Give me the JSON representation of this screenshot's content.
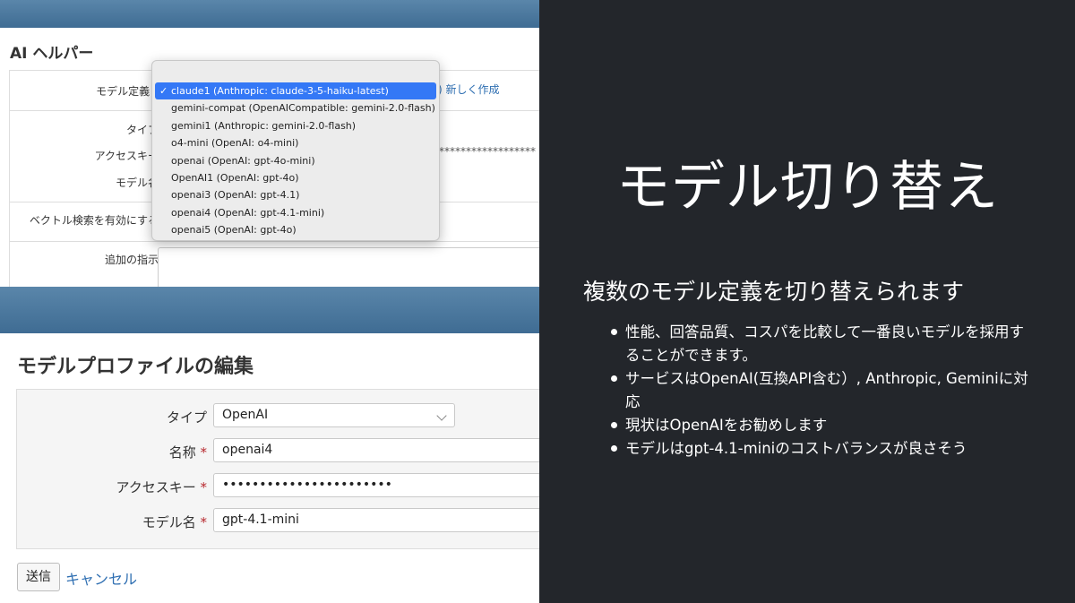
{
  "top_screen": {
    "page_title": "AI ヘルパー",
    "fields": {
      "model_definition_label": "モデル定義",
      "type_label": "タイプ",
      "access_key_label": "アクセスキー",
      "model_name_label": "モデル名",
      "vector_search_label": "ベクトル検索を有効にする",
      "extra_instructions_label": "追加の指示"
    },
    "required_mark": "*",
    "new_link": ") 新しく作成",
    "masked_value": "******************",
    "dropdown": {
      "check_mark": "✓",
      "options": [
        "claude1 (Anthropic: claude-3-5-haiku-latest)",
        "gemini-compat (OpenAICompatible: gemini-2.0-flash)",
        "gemini1 (Anthropic: gemini-2.0-flash)",
        "o4-mini (OpenAI: o4-mini)",
        "openai (OpenAI: gpt-4o-mini)",
        "OpenAI1 (OpenAI: gpt-4o)",
        "openai3 (OpenAI: gpt-4.1)",
        "openai4 (OpenAI: gpt-4.1-mini)",
        "openai5 (OpenAI: gpt-4o)"
      ],
      "selected_index": 0
    }
  },
  "bottom_screen": {
    "title": "モデルプロファイルの編集",
    "type_label": "タイプ",
    "type_value": "OpenAI",
    "name_label": "名称",
    "name_value": "openai4",
    "access_key_label": "アクセスキー",
    "access_key_value": "•••••••••••••••••••••••",
    "model_name_label": "モデル名",
    "model_name_value": "gpt-4.1-mini",
    "required_mark": "*",
    "submit_label": "送信",
    "cancel_label": "キャンセル"
  },
  "slide": {
    "title": "モデル切り替え",
    "subtitle": "複数のモデル定義を切り替えられます",
    "bullets": [
      "性能、回答品質、コスパを比較して一番良いモデルを採用することができます。",
      "サービスはOpenAI(互換API含む）, Anthropic, Geminiに対応",
      "現状はOpenAIをお勧めします",
      "モデルはgpt-4.1-miniのコストバランスが良さそう"
    ]
  },
  "colors": {
    "banner": "#4a7aa0",
    "slide_bg": "#23262b",
    "link": "#2f6fb2",
    "selected_option": "#3478f6",
    "required": "#b7282e"
  }
}
